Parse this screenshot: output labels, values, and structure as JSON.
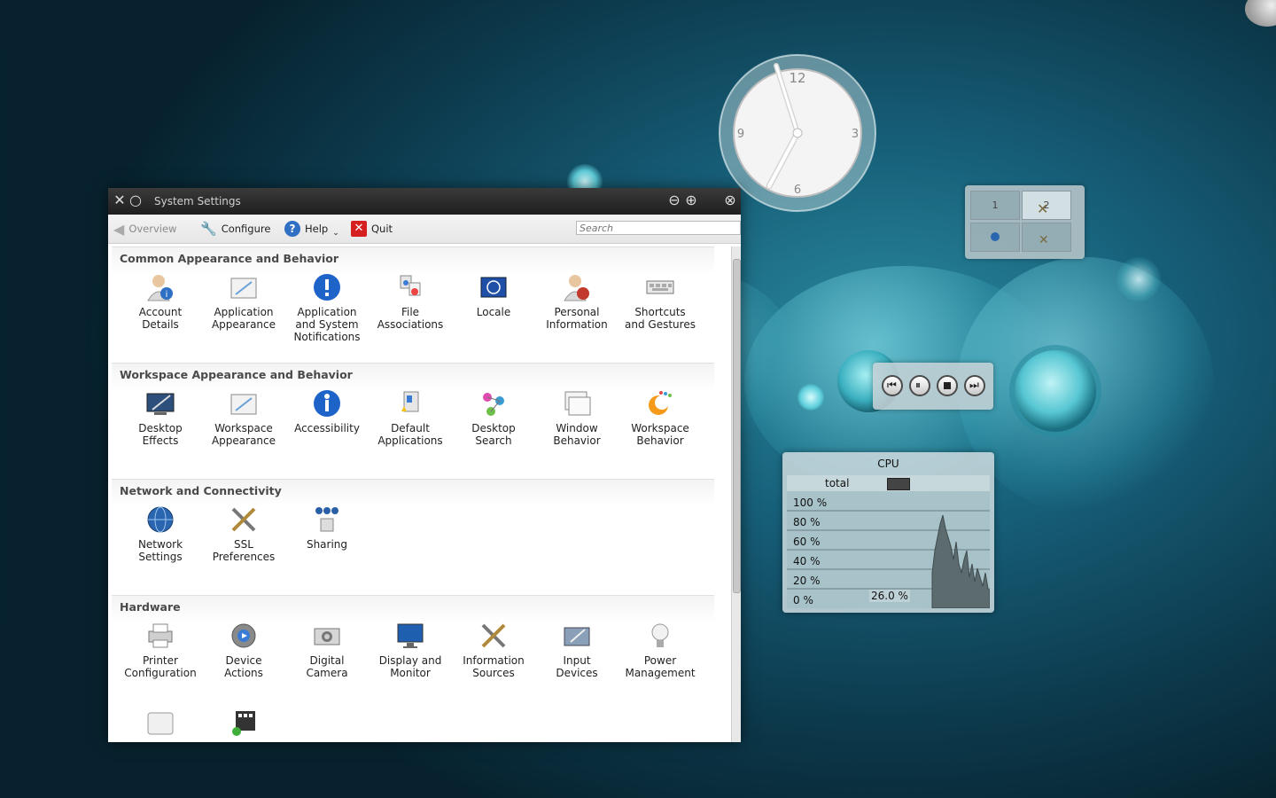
{
  "window": {
    "title": "System Settings",
    "toolbar": {
      "overview_label": "Overview",
      "configure_label": "Configure",
      "help_label": "Help",
      "quit_label": "Quit",
      "search_placeholder": "Search"
    },
    "sections": [
      {
        "title": "Common Appearance and Behavior",
        "items": [
          {
            "label": "Account\nDetails",
            "icon": "user-icon"
          },
          {
            "label": "Application\nAppearance",
            "icon": "appearance-icon"
          },
          {
            "label": "Application\nand System\nNotifications",
            "icon": "notifications-icon"
          },
          {
            "label": "File\nAssociations",
            "icon": "file-associations-icon"
          },
          {
            "label": "Locale",
            "icon": "locale-flag-icon"
          },
          {
            "label": "Personal\nInformation",
            "icon": "user-icon"
          },
          {
            "label": "Shortcuts\nand Gestures",
            "icon": "keyboard-icon"
          }
        ]
      },
      {
        "title": "Workspace Appearance and Behavior",
        "items": [
          {
            "label": "Desktop\nEffects",
            "icon": "desktop-effects-icon"
          },
          {
            "label": "Workspace\nAppearance",
            "icon": "appearance-icon"
          },
          {
            "label": "Accessibility",
            "icon": "accessibility-icon"
          },
          {
            "label": "Default\nApplications",
            "icon": "default-apps-icon"
          },
          {
            "label": "Desktop\nSearch",
            "icon": "desktop-search-icon"
          },
          {
            "label": "Window\nBehavior",
            "icon": "window-icon"
          },
          {
            "label": "Workspace\nBehavior",
            "icon": "workspace-icon"
          }
        ]
      },
      {
        "title": "Network and Connectivity",
        "items": [
          {
            "label": "Network\nSettings",
            "icon": "globe-icon"
          },
          {
            "label": "SSL\nPreferences",
            "icon": "tools-icon"
          },
          {
            "label": "Sharing",
            "icon": "sharing-icon"
          }
        ]
      },
      {
        "title": "Hardware",
        "items": [
          {
            "label": "Printer\nConfiguration",
            "icon": "printer-icon"
          },
          {
            "label": "Device\nActions",
            "icon": "gear-icon"
          },
          {
            "label": "Digital\nCamera",
            "icon": "camera-icon"
          },
          {
            "label": "Display and\nMonitor",
            "icon": "monitor-icon"
          },
          {
            "label": "Information\nSources",
            "icon": "tools-icon"
          },
          {
            "label": "Input\nDevices",
            "icon": "input-devices-icon"
          },
          {
            "label": "Power\nManagement",
            "icon": "lightbulb-icon"
          }
        ]
      }
    ],
    "partial_items": [
      {
        "icon": "drive-icon"
      },
      {
        "icon": "multimedia-icon"
      }
    ]
  },
  "clock": {
    "numerals": [
      "12",
      "3",
      "6",
      "9"
    ]
  },
  "pager": {
    "desktops": [
      "1",
      "2"
    ]
  },
  "cpu_widget": {
    "title": "CPU",
    "legend": "total",
    "y_ticks": [
      "100 %",
      "80 %",
      "60 %",
      "40 %",
      "20 %",
      "0 %"
    ],
    "current": "26.0 %"
  }
}
